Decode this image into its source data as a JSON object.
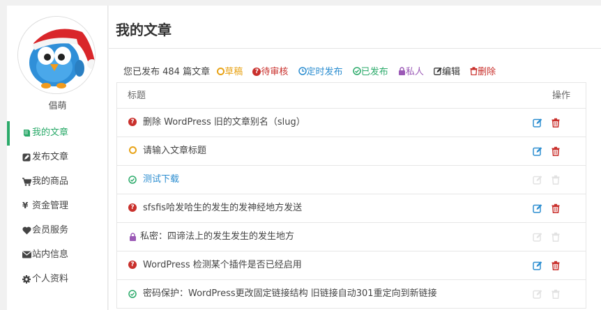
{
  "user": {
    "name": "倡萌"
  },
  "nav": [
    {
      "label": "我的文章",
      "icon": "book-icon",
      "active": true
    },
    {
      "label": "发布文章",
      "icon": "pencil-square-icon",
      "active": false
    },
    {
      "label": "我的商品",
      "icon": "cart-icon",
      "active": false
    },
    {
      "label": "资金管理",
      "icon": "yen-icon",
      "active": false
    },
    {
      "label": "会员服务",
      "icon": "heart-icon",
      "active": false
    },
    {
      "label": "站内信息",
      "icon": "envelope-icon",
      "active": false
    },
    {
      "label": "个人资料",
      "icon": "gear-icon",
      "active": false
    }
  ],
  "page": {
    "title": "我的文章"
  },
  "filters": {
    "count_text": "您已发布 484 篇文章",
    "draft": "草稿",
    "pending": "待审核",
    "future": "定时发布",
    "publish": "已发布",
    "private": "私人",
    "edit": "编辑",
    "delete": "删除"
  },
  "table": {
    "col_title": "标题",
    "col_ops": "操作",
    "rows": [
      {
        "title": "删除 WordPress 旧的文章别名（slug）",
        "status": "pending",
        "ops_enabled": true
      },
      {
        "title": "请输入文章标题",
        "status": "draft",
        "ops_enabled": true
      },
      {
        "title": "测试下载",
        "status": "publish",
        "ops_enabled": false
      },
      {
        "title": "sfsfis哈发哈生的发生的发神经地方发送",
        "status": "pending",
        "ops_enabled": true
      },
      {
        "title": "私密：四谛法上的发生发生的发生地方",
        "status": "private",
        "ops_enabled": false
      },
      {
        "title": "WordPress 检测某个插件是否已经启用",
        "status": "pending",
        "ops_enabled": true
      },
      {
        "title": "密码保护：WordPress更改固定链接结构 旧链接自动301重定向到新链接",
        "status": "publish",
        "ops_enabled": false
      }
    ]
  },
  "colors": {
    "accent_green": "#2baa6a",
    "pending_red": "#c9302c",
    "draft_orange": "#e8a317",
    "link_blue": "#2b8dd0",
    "private_purple": "#9b59b6"
  }
}
